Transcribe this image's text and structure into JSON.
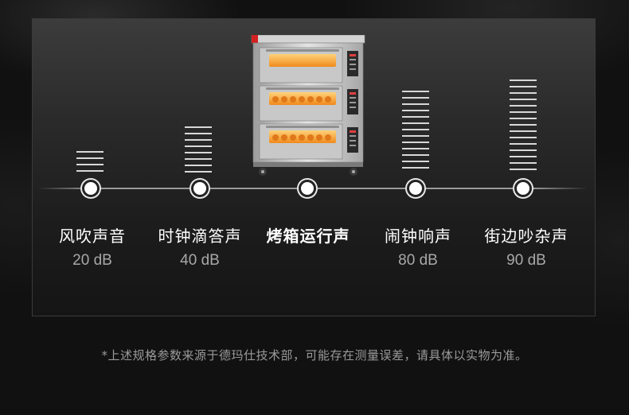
{
  "levels": [
    {
      "label": "风吹声音",
      "db": "20 dB",
      "bold": false
    },
    {
      "label": "时钟滴答声",
      "db": "40 dB",
      "bold": false
    },
    {
      "label": "烤箱运行声",
      "db": "",
      "bold": true
    },
    {
      "label": "闹钟响声",
      "db": "80 dB",
      "bold": false
    },
    {
      "label": "街边吵杂声",
      "db": "90 dB",
      "bold": false
    }
  ],
  "footnote": "*上述规格参数来源于德玛仕技术部，可能存在测量误差，请具体以实物为准。",
  "colors": {
    "background": "#121212",
    "panel_top": "#3c3c3c",
    "text_primary": "#ffffff",
    "text_secondary": "#a8a8a8",
    "oven_glow": "#f5a033"
  },
  "icons": [
    "oven-product-image"
  ]
}
